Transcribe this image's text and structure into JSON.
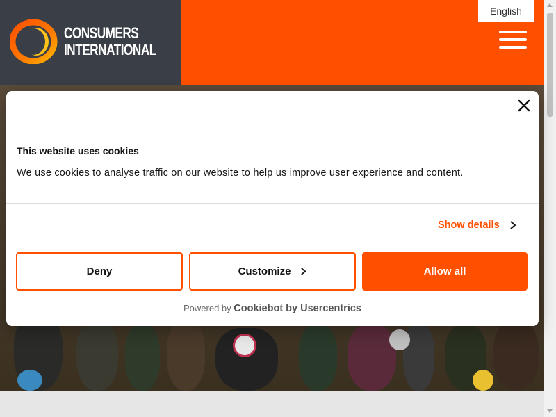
{
  "header": {
    "logo_line1": "CONSUMERS",
    "logo_line2": "INTERNATIONAL",
    "language": "English",
    "brand_color": "#ff5000",
    "dark_color": "#3a3f47"
  },
  "cookie_dialog": {
    "title": "This website uses cookies",
    "body": "We use cookies to analyse traffic on our website to help us improve user experience and content.",
    "show_details": "Show details",
    "deny_label": "Deny",
    "customize_label": "Customize",
    "allow_all_label": "Allow all",
    "powered_prefix": "Powered by",
    "powered_brand": "Cookiebot by Usercentrics",
    "close_icon": "close-icon"
  },
  "icons": {
    "menu": "hamburger-menu-icon",
    "chevron": "chevron-right-icon"
  }
}
